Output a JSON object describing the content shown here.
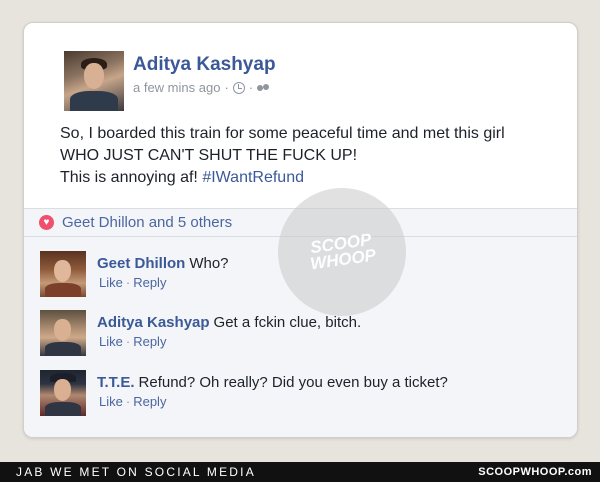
{
  "post": {
    "author": "Aditya Kashyap",
    "time": "a few mins ago",
    "meta_separator": "·",
    "privacy_icon": "friends-icon",
    "time_icon": "clock-icon",
    "body_lines": [
      "So, I boarded this train for some peaceful time and met this girl",
      "WHO JUST CAN'T SHUT THE FUCK UP!",
      "This is annoying af!"
    ],
    "hashtag": "#IWantRefund"
  },
  "likes": {
    "text": "Geet Dhillon and 5 others",
    "icon": "heart-icon"
  },
  "comments": [
    {
      "name": "Geet Dhillon",
      "text": "Who?",
      "like": "Like",
      "reply": "Reply",
      "sep": "·"
    },
    {
      "name": "Aditya Kashyap",
      "text": "Get a fckin clue, bitch.",
      "like": "Like",
      "reply": "Reply",
      "sep": "·"
    },
    {
      "name": "T.T.E.",
      "text": "Refund? Oh really? Did you even buy a ticket?",
      "like": "Like",
      "reply": "Reply",
      "sep": "·"
    }
  ],
  "watermark": {
    "line1": "SCOOP",
    "line2": "WHOOP"
  },
  "footer": {
    "caption": "JAB WE MET ON SOCIAL MEDIA",
    "brand": "SCOOPWHOOP.com"
  },
  "colors": {
    "link": "#3b5998",
    "heart": "#f0506e",
    "footer_bg": "#111111"
  }
}
